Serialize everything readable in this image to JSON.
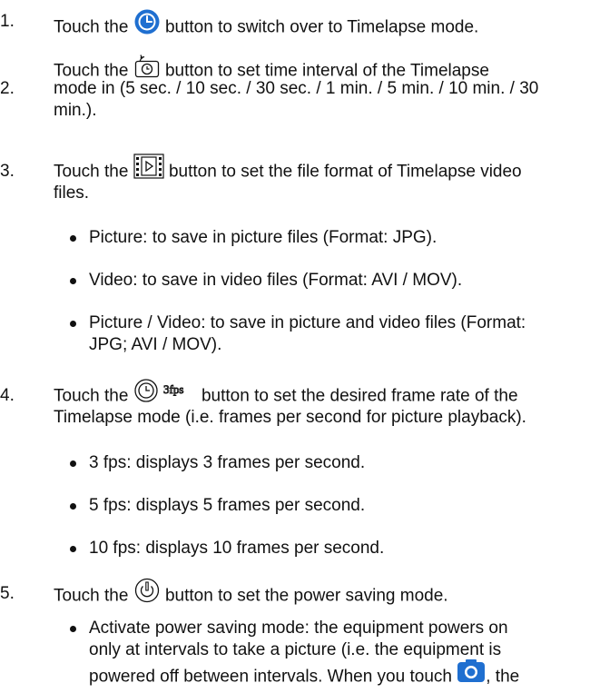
{
  "steps": [
    {
      "num": "1.",
      "pre": "Touch the",
      "post": "button to switch over to Timelapse mode.",
      "icon": "timelapse-clock-icon"
    },
    {
      "num": "2.",
      "pre": "Touch the",
      "post": "button to set time interval of the Timelapse",
      "line2": "mode in (5 sec. / 10 sec. / 30 sec. / 1 min. / 5 min. / 10 min. / 30",
      "line3": "min.).",
      "icon": "interval-timer-icon"
    },
    {
      "num": "3.",
      "pre": "Touch the",
      "post": "button to set the file format of Timelapse video",
      "line2": "files.",
      "icon": "film-format-icon"
    },
    {
      "num": "4.",
      "pre": "Touch the",
      "post": "button to set the desired frame rate of the",
      "line2": "Timelapse mode (i.e. frames per second for picture playback).",
      "icon": "frame-rate-icon",
      "icon_label": "3fps"
    },
    {
      "num": "5.",
      "pre": "Touch the",
      "post": "button to set the power saving mode.",
      "icon": "power-saving-icon"
    }
  ],
  "format_bullets": [
    "Picture: to save in picture files (Format: JPG).",
    "Video: to save in video files (Format: AVI / MOV).",
    "Picture / Video: to save in picture and video files (Format:",
    "JPG; AVI / MOV)."
  ],
  "fps_bullets": [
    "3 fps: displays 3 frames per second.",
    "5 fps: displays 5 frames per second.",
    "10 fps: displays 10 frames per second."
  ],
  "power_bullet": {
    "line1": "Activate power saving mode: the equipment powers on",
    "line2": "only at intervals to take a picture (i.e. the equipment is",
    "line3_pre": "powered off between intervals. When you touch",
    "line3_post": ", the",
    "icon": "camera-shutter-icon"
  }
}
